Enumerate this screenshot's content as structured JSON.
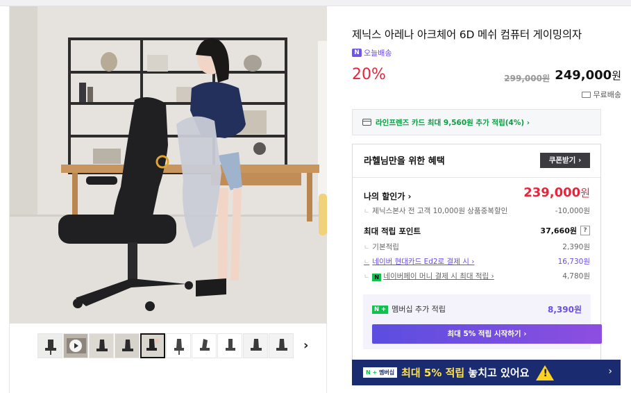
{
  "product": {
    "title": "제닉스 아레나 아크체어 6D 메쉬 컴퓨터 게이밍의자",
    "today_delivery": "오늘배송",
    "today_badge": "N",
    "discount_rate": "20%",
    "original_price": "299,000원",
    "sale_price": "249,000",
    "currency": "원",
    "shipping": "무료배송"
  },
  "card_banner": {
    "text": "라인프렌즈 카드 최대 9,560원 추가 적립(4%) ›"
  },
  "benefit": {
    "title": "라헬님만을 위한 혜택",
    "coupon_button": "쿠폰받기 ›",
    "my_discount_label": "나의 할인가 ›",
    "my_discount_price": "239,000",
    "my_discount_currency": "원",
    "discount_detail_label": "제닉스본사 전 고객 10,000원 상품중복할인",
    "discount_detail_value": "-10,000원",
    "points_title": "최대 적립 포인트",
    "points_value": "37,660원",
    "points_help": "?",
    "basic_points_label": "기본적립",
    "basic_points_value": "2,390원",
    "card_points_label": "네이버 현대카드 Ed2로 결제 시 ›",
    "card_points_value": "16,730원",
    "npay_label": "네이버페이 머니 결제 시 최대 적립 ›",
    "npay_badge": "N",
    "npay_value": "4,780원",
    "membership_label": "멤버십 추가 적립",
    "membership_badge": "N +",
    "membership_value": "8,390원",
    "membership_button": "최대 5% 적립 시작하기 ›"
  },
  "promo": {
    "badge_n": "N +",
    "badge_text": "멤버십",
    "text_highlight": "최대 5% 적립",
    "text_rest": " 놓치고 있어요",
    "chevron": "›"
  },
  "gallery": {
    "next_label": "›",
    "thumb_count": 10,
    "selected_index": 4
  }
}
